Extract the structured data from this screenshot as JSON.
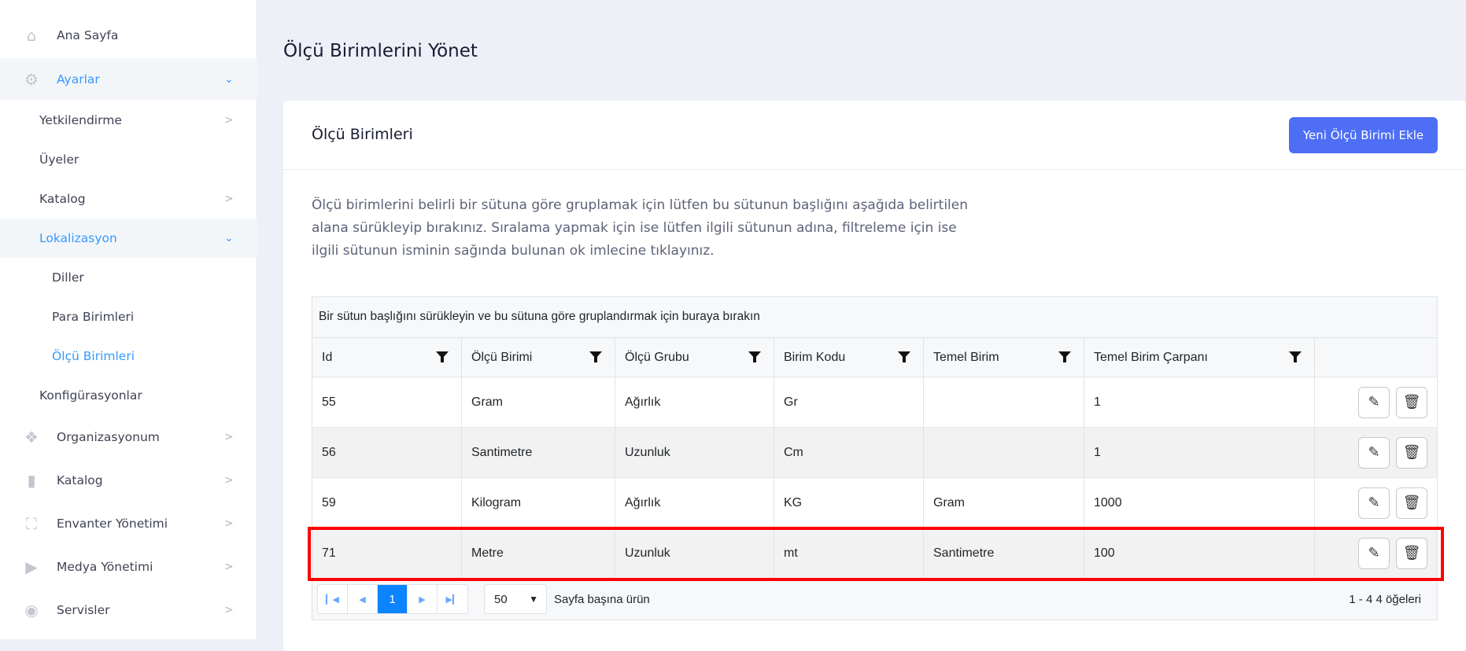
{
  "sidebar": {
    "items": [
      {
        "label": "Ana Sayfa",
        "icon": "home-icon"
      },
      {
        "label": "Ayarlar",
        "icon": "gear-icon"
      },
      {
        "label": "Yetkilendirme"
      },
      {
        "label": "Üyeler"
      },
      {
        "label": "Katalog"
      },
      {
        "label": "Lokalizasyon"
      },
      {
        "label": "Diller"
      },
      {
        "label": "Para Birimleri"
      },
      {
        "label": "Ölçü Birimleri"
      },
      {
        "label": "Konfigürasyonlar"
      },
      {
        "label": "Organizasyonum",
        "icon": "organization-icon"
      },
      {
        "label": "Katalog",
        "icon": "catalog-icon"
      },
      {
        "label": "Envanter Yönetimi",
        "icon": "inventory-icon"
      },
      {
        "label": "Medya Yönetimi",
        "icon": "media-folder-icon"
      },
      {
        "label": "Servisler",
        "icon": "broadcast-icon"
      }
    ]
  },
  "page": {
    "title": "Ölçü Birimlerini Yönet"
  },
  "card": {
    "title": "Ölçü Birimleri",
    "add_button": "Yeni Ölçü Birimi Ekle",
    "description": "Ölçü birimlerini belirli bir sütuna göre gruplamak için lütfen bu sütunun başlığını aşağıda belirtilen alana sürükleyip bırakınız. Sıralama yapmak için ise lütfen ilgili sütunun adına, filtreleme için ise ilgili sütunun isminin sağında bulunan ok imlecine tıklayınız."
  },
  "grid": {
    "group_panel": "Bir sütun başlığını sürükleyin ve bu sütuna göre gruplandırmak için buraya bırakın",
    "columns": [
      "Id",
      "Ölçü Birimi",
      "Ölçü Grubu",
      "Birim Kodu",
      "Temel Birim",
      "Temel Birim Çarpanı"
    ],
    "rows": [
      [
        "55",
        "Gram",
        "Ağırlık",
        "Gr",
        "",
        "1"
      ],
      [
        "56",
        "Santimetre",
        "Uzunluk",
        "Cm",
        "",
        "1"
      ],
      [
        "59",
        "Kilogram",
        "Ağırlık",
        "KG",
        "Gram",
        "1000"
      ],
      [
        "71",
        "Metre",
        "Uzunluk",
        "mt",
        "Santimetre",
        "100"
      ]
    ],
    "highlighted_row": 3,
    "pager": {
      "current": "1",
      "page_size": "50",
      "page_size_label": "Sayfa başına ürün",
      "summary": "1 - 4 4 öğeleri"
    }
  },
  "colors": {
    "accent": "#3699ff",
    "button": "#4d6ef5",
    "highlight": "#ff0000"
  }
}
